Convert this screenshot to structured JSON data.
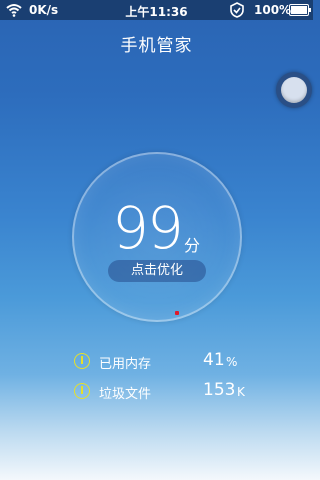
{
  "status_bar": {
    "network_speed": "0K/s",
    "time": "上午11:36",
    "battery_percent": "100%",
    "icons": [
      "wifi-icon",
      "alarm-icon",
      "battery-icon"
    ]
  },
  "app": {
    "title": "手机管家"
  },
  "score": {
    "value": "99",
    "unit": "分",
    "optimize_label": "点击优化"
  },
  "stats": [
    {
      "label": "已用内存",
      "value": "41",
      "unit": "%",
      "icon": "warning-icon"
    },
    {
      "label": "垃圾文件",
      "value": "153",
      "unit": "K",
      "icon": "warning-icon"
    }
  ],
  "colors": {
    "background_top": "#2a64b3",
    "background_bottom": "#f4f8fc",
    "status_bar": "#1a3f72",
    "warning_icon": "#e6e02a",
    "indicator_dot": "#e01a2a"
  }
}
